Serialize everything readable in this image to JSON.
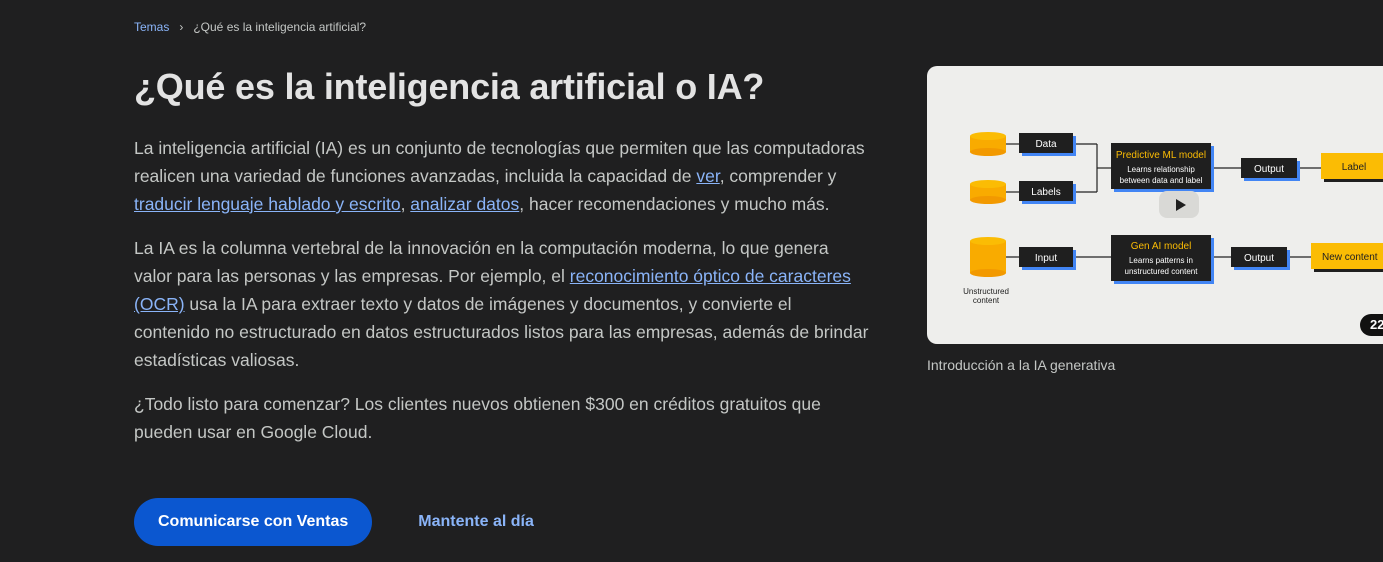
{
  "breadcrumb": {
    "root": "Temas",
    "separator": "›",
    "current": "¿Qué es la inteligencia artificial?"
  },
  "page": {
    "title": "¿Qué es la inteligencia artificial o IA?"
  },
  "paragraph1": {
    "t1": "La inteligencia artificial (IA) es un conjunto de tecnologías que permiten que las computadoras realicen una variedad de funciones avanzadas, incluida la capacidad de ",
    "link_ver": "ver",
    "t2": ", comprender y ",
    "link_traducir": "traducir lenguaje hablado y escrito",
    "t3": ", ",
    "link_analizar": "analizar datos",
    "t4": ", hacer recomendaciones y mucho más."
  },
  "paragraph2": {
    "t1": "La IA es la columna vertebral de la innovación en la computación moderna, lo que genera valor para las personas y las empresas. Por ejemplo, el ",
    "link_ocr": "reconocimiento óptico de caracteres (OCR)",
    "t2": " usa la IA para extraer texto y datos de imágenes y documentos, y convierte el contenido no estructurado en datos estructurados listos para las empresas, además de brindar estadísticas valiosas."
  },
  "paragraph3": {
    "text": "¿Todo listo para comenzar? Los clientes nuevos obtienen $300 en créditos gratuitos que pueden usar en Google Cloud."
  },
  "cta": {
    "primary_label": "Comunicarse con Ventas",
    "secondary_label": "Mantente al día"
  },
  "video": {
    "caption": "Introducción a la IA generativa",
    "duration": "22",
    "diagram": {
      "data": "Data",
      "labels": "Labels",
      "predictive_title": "Predictive ML model",
      "predictive_sub1": "Learns relationship",
      "predictive_sub2": "between data and label",
      "output": "Output",
      "label": "Label",
      "input": "Input",
      "genai_title": "Gen AI model",
      "genai_sub1": "Learns patterns in",
      "genai_sub2": "unstructured content",
      "new_content": "New content",
      "unstructured1": "Unstructured",
      "unstructured2": "content"
    }
  },
  "colors": {
    "background": "#1f1f20",
    "link": "#8ab4f8",
    "primary_button": "#0b57d0",
    "diagram_accent": "#fbbc04"
  }
}
